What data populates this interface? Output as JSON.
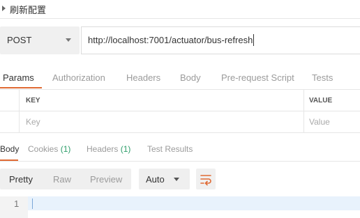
{
  "header": {
    "title": "刷新配置"
  },
  "request": {
    "method": "POST",
    "url": "http://localhost:7001/actuator/bus-refresh"
  },
  "request_tabs": [
    "Params",
    "Authorization",
    "Headers",
    "Body",
    "Pre-request Script",
    "Tests"
  ],
  "params_table": {
    "columns": {
      "key": "KEY",
      "value": "VALUE"
    },
    "placeholders": {
      "key": "Key",
      "value": "Value"
    }
  },
  "response_tabs": {
    "body": "Body",
    "cookies": "Cookies",
    "cookies_count": "(1)",
    "headers": "Headers",
    "headers_count": "(1)",
    "test_results": "Test Results"
  },
  "response_toolbar": {
    "views": [
      "Pretty",
      "Raw",
      "Preview"
    ],
    "format": "Auto"
  },
  "editor": {
    "line_number": "1"
  },
  "colors": {
    "accent": "#e06a34",
    "count_green": "#2e9e6a"
  }
}
